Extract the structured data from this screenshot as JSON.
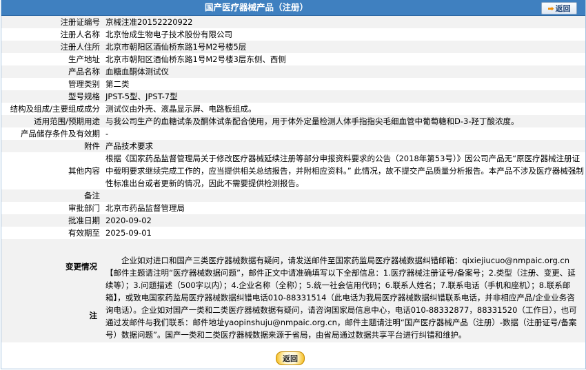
{
  "header": {
    "title": "国产医疗器械产品（注册）",
    "back_label": "返回"
  },
  "rows": [
    {
      "label": "注册证编号",
      "value": "京械注准20152220922"
    },
    {
      "label": "注册人名称",
      "value": "北京怡成生物电子技术股份有限公司"
    },
    {
      "label": "注册人住所",
      "value": "北京市朝阳区酒仙桥东路1号M2号楼5层"
    },
    {
      "label": "生产地址",
      "value": "北京市朝阳区酒仙桥东路1号M2号楼3层东侧、西侧"
    },
    {
      "label": "产品名称",
      "value": "血糖血酮体测试仪"
    },
    {
      "label": "管理类别",
      "value": "第二类"
    },
    {
      "label": "型号规格",
      "value": "JPST-5型、JPST-7型"
    },
    {
      "label": "结构及组成/主要组成成分",
      "value": "测试仪由外壳、液晶显示屏、电路板组成。"
    },
    {
      "label": "适用范围/预期用途",
      "value": "与我公司生产的血糖试条及酮体试条配合使用，用于体外定量检测人体手指指尖毛细血管中葡萄糖和D-3-羟丁酸浓度。"
    },
    {
      "label": "产品储存条件及有效期",
      "value": "-"
    },
    {
      "label": "附件",
      "value": "产品技术要求"
    },
    {
      "label": "其他内容",
      "value": "根据《国家药品监督管理局关于修改医疗器械延续注册等部分申报资料要求的公告（2018年第53号）》因公司产品无“原医疗器械注册证中载明要求继续完成工作的，应当提供相关总结报告，并附相应资料。” 此情况，故不提交产品质量分析报告。本产品不涉及医疗器械强制性标准出台或者更新的情况，因此不需要提供检测报告。"
    },
    {
      "label": "备注",
      "value": ""
    },
    {
      "label": "审批部门",
      "value": "北京市药品监督管理局"
    },
    {
      "label": "批准日期",
      "value": "2020-09-02"
    },
    {
      "label": "有效期至",
      "value": "2025-09-01"
    }
  ],
  "change": {
    "label": "变更情况",
    "value": ""
  },
  "note": {
    "label": "注",
    "text": "企业如对进口和国产三类医疗器械数据有疑问，请发送邮件至国家药监局医疗器械数据纠错邮箱：qixiejiucuo@nmpaic.org.cn【邮件主题请注明“医疗器械数据问题”，邮件正文中请准确填写以下全部信息：1.医疗器械注册证号/备案号；2.类型（注册、变更、延续等）；3.问题描述（500字以内）；4.企业名称（全称）；5.统一社会信用代码；6.联系人姓名；7.联系电话（手机和座机）；8.联系邮箱】，或致电国家药监局医疗器械数据纠错电话010-88331514（此电话为我局医疗器械数据纠错联系电话，并非相应产品/企业业务咨询电话）。企业如对国产一类和二类医疗器械数据有疑问，请咨询国家局信息中心，电话010-88332877，88331520（工作日），也可通过发邮件与我们联系：邮件地址yaopinshuju@nmpaic.org.cn，邮件主题请注明“国产医疗器械产品（注册）-数据（注册证号/备案号）数据问题”。国产一类和二类医疗器械数据来源于省局，由省局通过数据共享平台进行纠错和维护。"
  },
  "footer": {
    "back_label": "返回"
  }
}
